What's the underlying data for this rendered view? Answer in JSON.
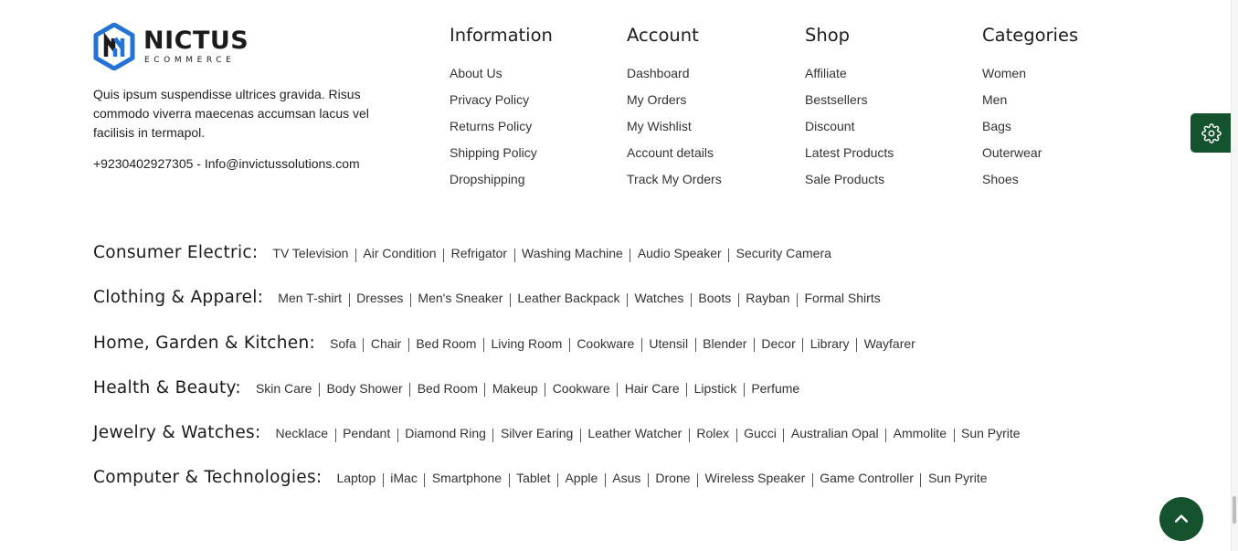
{
  "brand": {
    "name": "NICTUS",
    "subtitle": "ECOMMERCE",
    "description": "Quis ipsum suspendisse ultrices gravida. Risus commodo viverra maecenas accumsan lacus vel facilisis in termapol.",
    "contact": "+9230402927305 - Info@invictussolutions.com",
    "colors": {
      "logo_blue": "#2373d6",
      "logo_dark": "#1b1b1b"
    }
  },
  "columns": {
    "information": {
      "title": "Information",
      "links": [
        "About Us",
        "Privacy Policy",
        "Returns Policy",
        "Shipping Policy",
        "Dropshipping"
      ]
    },
    "account": {
      "title": "Account",
      "links": [
        "Dashboard",
        "My Orders",
        "My Wishlist",
        "Account details",
        "Track My Orders"
      ]
    },
    "shop": {
      "title": "Shop",
      "links": [
        "Affiliate",
        "Bestsellers",
        "Discount",
        "Latest Products",
        "Sale Products"
      ]
    },
    "categories": {
      "title": "Categories",
      "links": [
        "Women",
        "Men",
        "Bags",
        "Outerwear",
        "Shoes"
      ]
    }
  },
  "category_rows": [
    {
      "title": "Consumer Electric:",
      "links": [
        "TV Television",
        "Air Condition",
        "Refrigator",
        "Washing Machine",
        "Audio Speaker",
        "Security Camera"
      ]
    },
    {
      "title": "Clothing & Apparel:",
      "links": [
        "Men T-shirt",
        "Dresses",
        "Men's Sneaker",
        "Leather Backpack",
        "Watches",
        "Boots",
        "Rayban",
        "Formal Shirts"
      ]
    },
    {
      "title": "Home, Garden & Kitchen:",
      "links": [
        "Sofa",
        "Chair",
        "Bed Room",
        "Living Room",
        "Cookware",
        "Utensil",
        "Blender",
        "Decor",
        "Library",
        "Wayfarer"
      ]
    },
    {
      "title": "Health & Beauty:",
      "links": [
        "Skin Care",
        "Body Shower",
        "Bed Room",
        "Makeup",
        "Cookware",
        "Hair Care",
        "Lipstick",
        "Perfume"
      ]
    },
    {
      "title": "Jewelry & Watches:",
      "links": [
        "Necklace",
        "Pendant",
        "Diamond Ring",
        "Silver Earing",
        "Leather Watcher",
        "Rolex",
        "Gucci",
        "Australian Opal",
        "Ammolite",
        "Sun Pyrite"
      ]
    },
    {
      "title": "Computer & Technologies:",
      "links": [
        "Laptop",
        "iMac",
        "Smartphone",
        "Tablet",
        "Apple",
        "Asus",
        "Drone",
        "Wireless Speaker",
        "Game Controller",
        "Sun Pyrite"
      ]
    }
  ],
  "floating": {
    "settings_icon": "gear-icon",
    "scroll_top_icon": "chevron-up-icon",
    "accent_color": "#14532d"
  }
}
